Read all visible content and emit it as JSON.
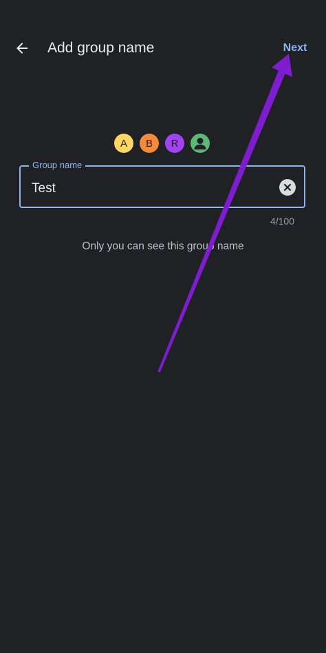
{
  "app_bar": {
    "back_icon": "arrow-left-icon",
    "title": "Add group name",
    "next_label": "Next"
  },
  "avatars": [
    {
      "letter": "A",
      "color": "#fdd663"
    },
    {
      "letter": "B",
      "color": "#f28b3a"
    },
    {
      "letter": "R",
      "color": "#a142f4"
    },
    {
      "letter": "",
      "icon": "person-icon",
      "color": "#5bb974"
    }
  ],
  "group_name_field": {
    "label": "Group name",
    "value": "Test",
    "clear_icon": "clear-icon",
    "counter": "4/100"
  },
  "helper_text": "Only you can see this group name",
  "colors": {
    "background": "#202124",
    "accent": "#8ab4f8",
    "annotation_arrow": "#7e1ccf"
  }
}
